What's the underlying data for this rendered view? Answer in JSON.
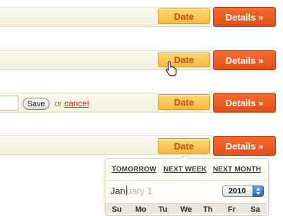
{
  "rows": [
    {
      "date_label": "Date",
      "details_label": "Details »"
    },
    {
      "date_label": "Date",
      "details_label": "Details »"
    },
    {
      "date_label": "Date",
      "details_label": "Details »"
    },
    {
      "date_label": "Date",
      "details_label": "Details »"
    }
  ],
  "edit_row": {
    "input_value": "",
    "save_label": "Save",
    "or_text": "or",
    "cancel_label": "cancel"
  },
  "picker": {
    "quick": [
      "TOMORROW",
      "NEXT WEEK",
      "NEXT MONTH"
    ],
    "typed": "Jan",
    "hint": "uary 1",
    "year": "2010",
    "weekdays": [
      "Su",
      "Mo",
      "Tu",
      "We",
      "Th",
      "Fr",
      "Sa"
    ]
  },
  "colors": {
    "date_button": "#f7b93f",
    "details_button": "#e0501b",
    "cancel_link": "#c0301c"
  },
  "icons": {
    "cursor": "hand-pointer-icon",
    "year_stepper": "up-down-arrows-icon"
  }
}
